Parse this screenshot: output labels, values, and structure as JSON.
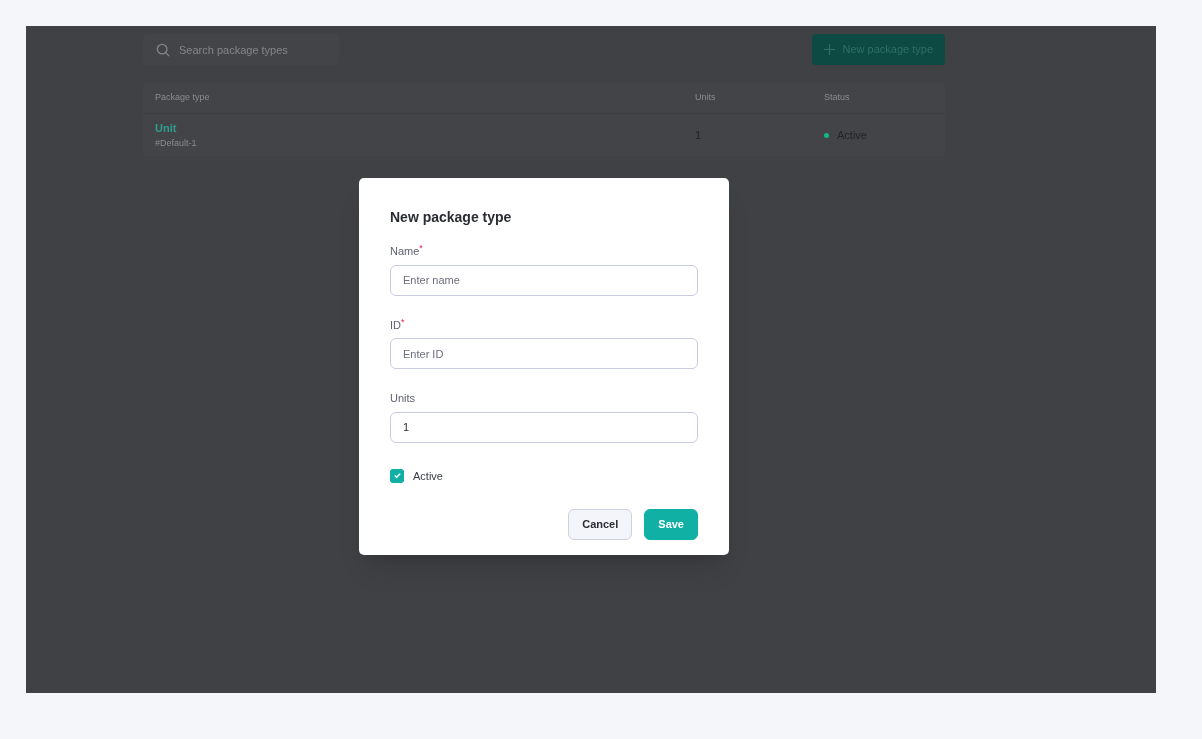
{
  "search": {
    "placeholder": "Search package types"
  },
  "new_button": {
    "label": "New package type"
  },
  "table": {
    "columns": [
      "Package type",
      "Units",
      "Status"
    ],
    "rows": [
      {
        "name": "Unit",
        "id": "#Default-1",
        "units": "1",
        "status": "Active",
        "color": "#10b981"
      }
    ]
  },
  "dialog": {
    "title": "New package type",
    "fields": [
      {
        "label": "Name",
        "required_mark": "*",
        "placeholder": "Enter name"
      },
      {
        "label": "ID",
        "required_mark": "*",
        "placeholder": "Enter ID"
      },
      {
        "label": "Units",
        "value": "1"
      }
    ],
    "checkbox": {
      "label": "Active",
      "checked": true
    },
    "buttons": [
      {
        "label": "Cancel",
        "kind": "secondary"
      },
      {
        "label": "Save",
        "kind": "primary"
      }
    ]
  }
}
